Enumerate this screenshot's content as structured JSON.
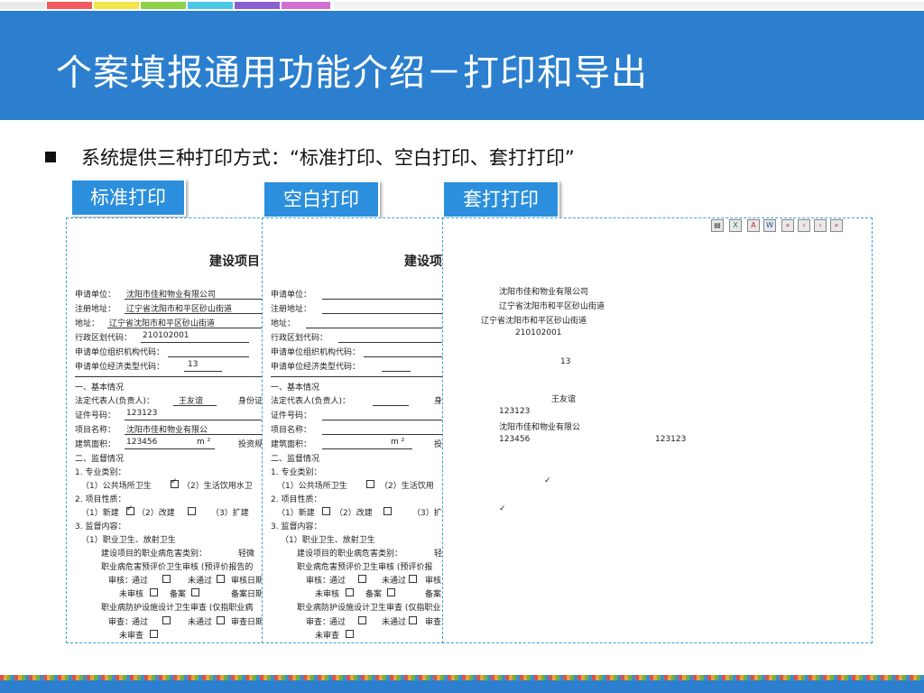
{
  "title": "个案填报通用功能介绍－打印和导出",
  "bullet": "系统提供三种打印方式：“标准打印、空白打印、套打打印”",
  "tags": {
    "standard": "标准打印",
    "blank": "空白打印",
    "overlay": "套打打印"
  },
  "toolbar_icons": [
    "print-icon",
    "excel-icon",
    "pdf-icon",
    "word-icon",
    "first-page-icon",
    "prev-page-icon",
    "next-page-icon",
    "last-page-icon"
  ],
  "colors": {
    "accent": "#2b7fce",
    "tag_bg": "#2b8fdd",
    "panel_border": "#3aa0d8"
  },
  "form": {
    "title_std": "建设项目",
    "title_blank": "建设项",
    "apply_unit_label": "申请单位：",
    "apply_unit_value": "沈阳市佳和物业有限公司",
    "reg_addr_label": "注册地址：",
    "reg_addr_value": "辽宁省沈阳市和平区砂山街道",
    "addr_label": "地址：",
    "addr_value": "辽宁省沈阳市和平区砂山街道",
    "region_code_label": "行政区划代码：",
    "region_code_value": "210102001",
    "org_code_label": "申请单位组织机构代码：",
    "econ_code_label": "申请单位经济类型代码：",
    "econ_code_value": "13",
    "sec1": "一、基本情况",
    "legal_rep_label": "法定代表人(负责人)：",
    "legal_rep_value": "王友谊",
    "id_label_std": "身份证",
    "id_label_blank": "身",
    "cert_no_label": "证件号码：",
    "cert_no_value": "123123",
    "project_label": "项目名称：",
    "project_value": "沈阳市佳和物业有限公",
    "area_label": "建筑面积：",
    "area_value": "123456",
    "area_unit": "m ²",
    "invest_std": "投资规",
    "invest_blank": "投",
    "invest_value": "123123",
    "sec2": "二、监督情况",
    "prof_label": "1. 专业类别：",
    "prof_opt1": "（1）公共场所卫生",
    "prof_opt2_std": "（2）生活饮用水卫",
    "prof_opt2_blank": "（2）生活饮用",
    "nature_label": "2. 项目性质：",
    "nature_opt1": "（1）新建",
    "nature_opt2": "（2）改建",
    "nature_opt3_std": "（3）扩建",
    "nature_opt3_blank": "（3）扩",
    "content_label": "3. 监督内容：",
    "occ_label": "（1）职业卫生、放射卫生",
    "hazard_label": "建设项目的职业病危害类别：",
    "hazard_value_std": "轻微",
    "hazard_value_blank": "轻",
    "preeval_std": "职业病危害预评价卫生审核 (预评价报告的",
    "preeval_blank": "职业病危害预评价卫生审核 (预评价报",
    "review_label": "审核：",
    "pass": "通过",
    "not_pass": "未通过",
    "review_date_std": "审核日期",
    "review_date_blank": "审核",
    "not_reviewed": "未审核",
    "filed": "备案",
    "filed_date_std": "备案日期",
    "filed_date_blank": "备案",
    "design_std": "职业病防护设施设计卫生审查 (仅指职业病",
    "design_blank": "职业病防护设施设计卫生审查 (仅指职业",
    "exam_label": "审查：",
    "exam_date_std": "审查日期",
    "exam_date_blank": "审查",
    "not_examined": "未审查",
    "tick": "✓",
    "box": "☐"
  }
}
